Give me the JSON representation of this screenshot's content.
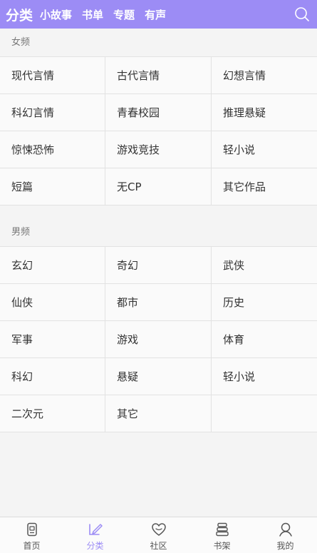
{
  "header": {
    "tabs": [
      {
        "label": "分类",
        "active": true
      },
      {
        "label": "小故事"
      },
      {
        "label": "书单"
      },
      {
        "label": "专题"
      },
      {
        "label": "有声"
      }
    ],
    "search_icon": "search-icon"
  },
  "female": {
    "title": "女频",
    "items": [
      "现代言情",
      "古代言情",
      "幻想言情",
      "科幻言情",
      "青春校园",
      "推理悬疑",
      "惊悚恐怖",
      "游戏竞技",
      "轻小说",
      "短篇",
      "无CP",
      "其它作品"
    ]
  },
  "male": {
    "title": "男频",
    "items": [
      "玄幻",
      "奇幻",
      "武侠",
      "仙侠",
      "都市",
      "历史",
      "军事",
      "游戏",
      "体育",
      "科幻",
      "悬疑",
      "轻小说",
      "二次元",
      "其它",
      ""
    ]
  },
  "bottom_nav": [
    {
      "label": "首页",
      "icon": "home-book-icon"
    },
    {
      "label": "分类",
      "icon": "category-pen-icon",
      "active": true
    },
    {
      "label": "社区",
      "icon": "community-heart-icon"
    },
    {
      "label": "书架",
      "icon": "bookshelf-stack-icon"
    },
    {
      "label": "我的",
      "icon": "profile-person-icon"
    }
  ],
  "colors": {
    "accent": "#9c8cf5",
    "background": "#f4f4f4",
    "cell": "#fafafa"
  }
}
